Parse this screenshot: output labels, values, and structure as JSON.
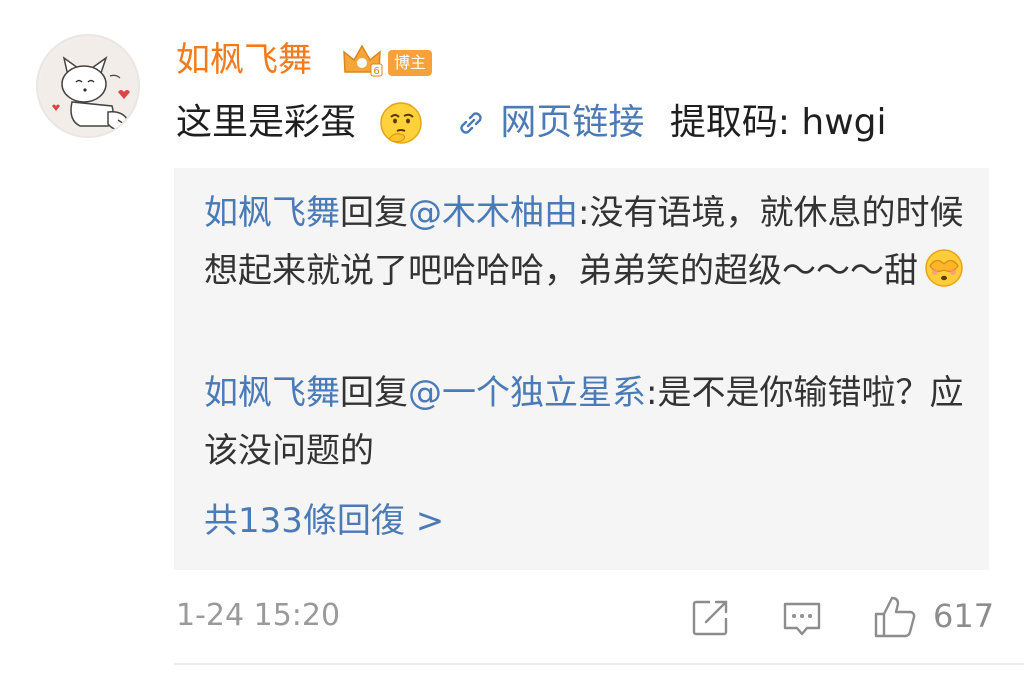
{
  "comment": {
    "avatar": "fox-avatar",
    "username": "如枫飞舞",
    "badges": {
      "crown": "crown-icon",
      "host_label": "博主"
    },
    "text": "这里是彩蛋",
    "emoji": "thinking-face-emoji",
    "link_label": "网页链接",
    "code_label": "提取码: hwgi",
    "timestamp": "1-24 15:20",
    "likes": "617"
  },
  "replies": [
    {
      "name": "如枫飞舞",
      "verb": "回复",
      "mention": "@木木柚由",
      "text": ":没有语境，就休息的时候想起来就说了吧哈哈哈，弟弟笑的超级～～～甜",
      "emoji": "shy-face-emoji"
    },
    {
      "name": "如枫飞舞",
      "verb": "回复",
      "mention": "@一个独立星系",
      "text": ":是不是你输错啦？应该没问题的"
    }
  ],
  "total_replies_label": "共133條回復 >",
  "colors": {
    "username": "#f27b1d",
    "link": "#4a7bb7",
    "host_badge": "#f6a13b",
    "reply_bg": "#f5f5f5"
  }
}
